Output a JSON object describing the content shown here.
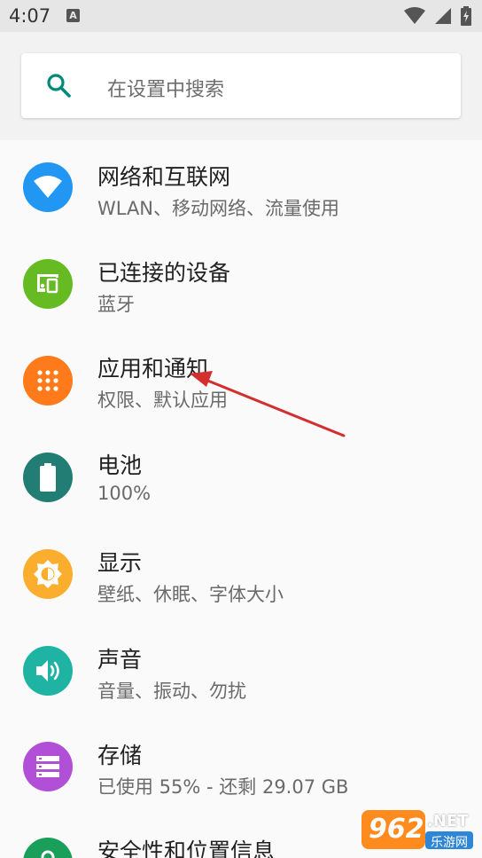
{
  "status": {
    "time": "4:07",
    "a_badge": "A"
  },
  "search": {
    "placeholder": "在设置中搜索"
  },
  "items": [
    {
      "title": "网络和互联网",
      "subtitle": "WLAN、移动网络、流量使用",
      "color": "#2196f3",
      "icon": "wifi-icon"
    },
    {
      "title": "已连接的设备",
      "subtitle": "蓝牙",
      "color": "#66bb22",
      "icon": "devices-icon"
    },
    {
      "title": "应用和通知",
      "subtitle": "权限、默认应用",
      "color": "#ff7a1a",
      "icon": "apps-grid-icon"
    },
    {
      "title": "电池",
      "subtitle": "100%",
      "color": "#227e74",
      "icon": "battery-icon"
    },
    {
      "title": "显示",
      "subtitle": "壁纸、休眠、字体大小",
      "color": "#fbae2e",
      "icon": "brightness-icon"
    },
    {
      "title": "声音",
      "subtitle": "音量、振动、勿扰",
      "color": "#1eb3a2",
      "icon": "volume-icon"
    },
    {
      "title": "存储",
      "subtitle": "已使用 55% - 还剩 29.07 GB",
      "color": "#b14fd6",
      "icon": "storage-icon"
    },
    {
      "title": "安全性和位置信息",
      "subtitle": "",
      "color": "#1a9f5a",
      "icon": "lock-icon"
    }
  ],
  "watermark": {
    "number": "962",
    "suffix": ".NET",
    "site": "乐游网"
  },
  "colors": {
    "accent": "#00897b",
    "annotation_arrow": "#d32f2f"
  }
}
